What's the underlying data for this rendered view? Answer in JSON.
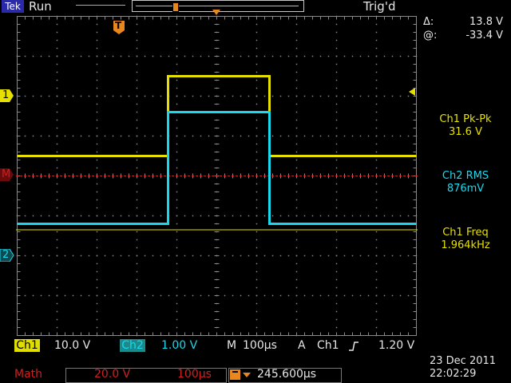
{
  "status": {
    "brand": "Tek",
    "state": "Run",
    "trigger_state": "Trig'd"
  },
  "cursor_readout": {
    "delta_label": "Δ:",
    "delta_value": "13.8 V",
    "at_label": "@:",
    "at_value": "-33.4 V"
  },
  "measurements": [
    {
      "label": "Ch1 Pk-Pk",
      "value": "31.6 V",
      "color": "#e5e000"
    },
    {
      "label": "Ch2 RMS",
      "value": "876mV",
      "color": "#19d8ee"
    },
    {
      "label": "Ch1 Freq",
      "value": "1.964kHz",
      "color": "#e5e000"
    }
  ],
  "channel_markers": {
    "ch1": "1",
    "ch2": "2",
    "math": "M",
    "trigger": "T"
  },
  "bottom": {
    "ch1_label": "Ch1",
    "ch1_scale": "10.0 V",
    "ch2_label": "Ch2",
    "ch2_scale": "1.00 V",
    "timebase_label": "M",
    "timebase": "100µs",
    "trigger_mode": "A",
    "trigger_source": "Ch1",
    "trigger_slope_icon": "rising-edge-icon",
    "trigger_level": "1.20 V",
    "math_label": "Math",
    "math_scale": "20.0 V",
    "math_timebase": "100µs",
    "trigger_position": "245.600µs"
  },
  "datetime": {
    "date": "23 Dec 2011",
    "time": "22:02:29"
  },
  "colors": {
    "ch1": "#e5e000",
    "ch2": "#19d8ee",
    "math": "#d02020",
    "trigger_marker": "#e8871e",
    "grid": "#8a8a8a"
  },
  "waveforms": {
    "ch1": {
      "low_div": 0.5,
      "high_div": 2.5,
      "rise_us": -122,
      "fall_us": 132
    },
    "ch2": {
      "low_div": -1.2,
      "high_div": 1.6,
      "rise_us": -122,
      "fall_us": 132
    },
    "math_level_div": 0
  }
}
